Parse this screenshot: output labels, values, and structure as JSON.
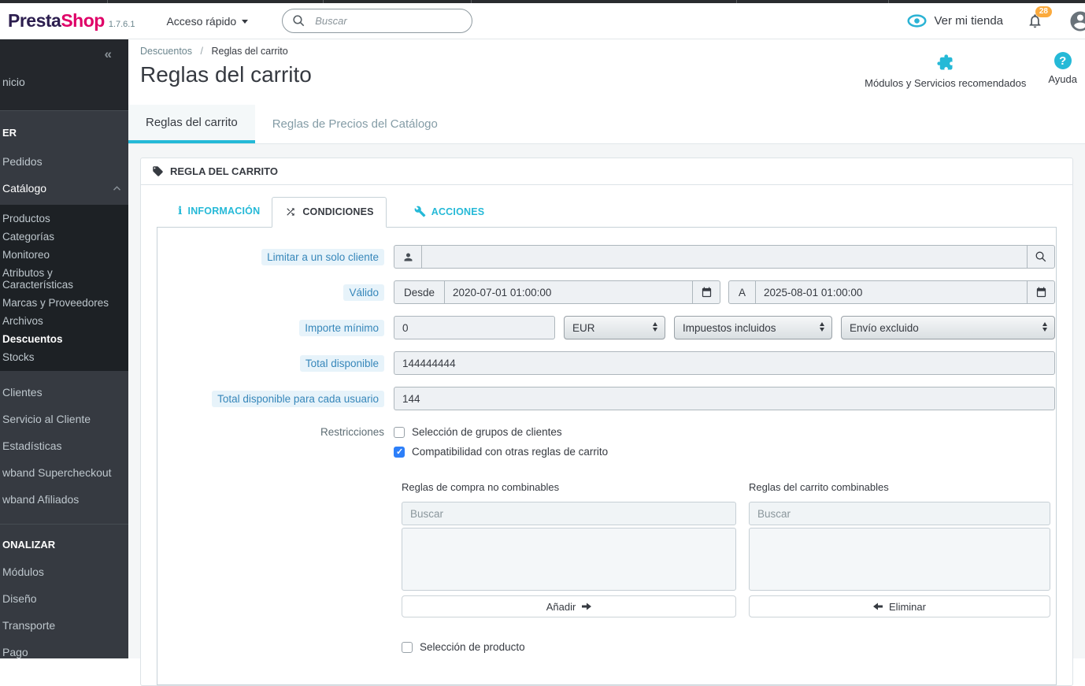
{
  "colors": {
    "accent": "#25b9d7",
    "badge": "#fbaa3d",
    "label_blue": "#3787ba",
    "checkbox_blue": "#2d7ff9",
    "logo_dark": "#2c1e4f",
    "logo_pink": "#df0067"
  },
  "header": {
    "logo_presta": "Presta",
    "logo_shop": "Shop",
    "version": "1.7.6.1",
    "quick_access": "Acceso rápido",
    "search_placeholder": "Buscar",
    "view_shop": "Ver mi tienda",
    "notifications_count": "28"
  },
  "sidebar": {
    "collapse": "«",
    "home": "nicio",
    "sell_header": "ER",
    "pedidos": "Pedidos",
    "catalogo": "Catálogo",
    "sub": [
      "Productos",
      "Categorías",
      "Monitoreo",
      "Atributos y Características",
      "Marcas y Proveedores",
      "Archivos",
      "Descuentos",
      "Stocks"
    ],
    "clientes": "Clientes",
    "servicio": "Servicio al Cliente",
    "estadisticas": "Estadísticas",
    "kb_supercheckout": "wband Supercheckout",
    "kb_afiliados": "wband Afiliados",
    "personalize_header": "ONALIZAR",
    "modulos": "Módulos",
    "diseno": "Diseño",
    "transporte": "Transporte",
    "pago": "Pago"
  },
  "breadcrumb": {
    "parent": "Descuentos",
    "separator": "/",
    "current": "Reglas del carrito"
  },
  "page": {
    "title": "Reglas del carrito",
    "modules_link": "Módulos y Servicios recomendados",
    "help_link": "Ayuda"
  },
  "tabs": {
    "cart_rules": "Reglas del carrito",
    "catalog_price_rules": "Reglas de Precios del Catálogo"
  },
  "panel": {
    "title": "REGLA DEL CARRITO",
    "subtab_info": "INFORMACIÓN",
    "subtab_conditions": "CONDICIONES",
    "subtab_actions": "ACCIONES"
  },
  "form": {
    "customer": {
      "label": "Limitar a un solo cliente",
      "value": ""
    },
    "valid": {
      "label": "Válido",
      "from_prefix": "Desde",
      "from_value": "2020-07-01 01:00:00",
      "to_prefix": "A",
      "to_value": "2025-08-01 01:00:00"
    },
    "min_amount": {
      "label": "Importe mínimo",
      "value": "0",
      "currency": "EUR",
      "tax": "Impuestos incluidos",
      "shipping": "Envío excluido"
    },
    "total_available": {
      "label": "Total disponible",
      "value": "144444444"
    },
    "total_per_user": {
      "label": "Total disponible para cada usuario",
      "value": "144"
    },
    "restrictions": {
      "label": "Restricciones",
      "cb_groups": {
        "label": "Selección de grupos de clientes",
        "checked": false
      },
      "cb_compat": {
        "label": "Compatibilidad con otras reglas de carrito",
        "checked": true
      },
      "uncombinable": {
        "title": "Reglas de compra no combinables",
        "search_placeholder": "Buscar",
        "button": "Añadir"
      },
      "combinable": {
        "title": "Reglas del carrito combinables",
        "search_placeholder": "Buscar",
        "button": "Eliminar"
      },
      "cb_product": {
        "label": "Selección de producto",
        "checked": false
      }
    }
  }
}
